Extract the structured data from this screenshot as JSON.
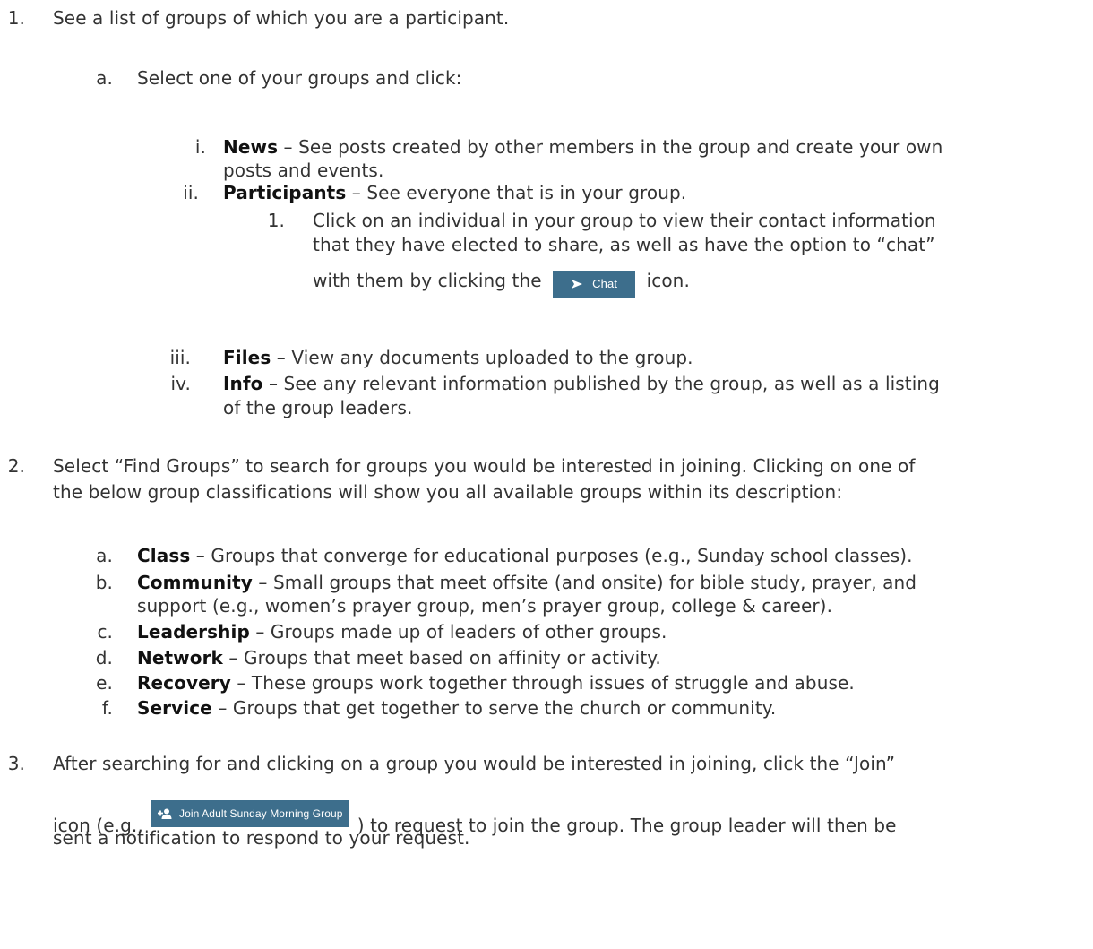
{
  "items": [
    {
      "num": "1.",
      "text": "See a list of groups of which you are a participant."
    },
    {
      "num": "a.",
      "text": "Select one of your groups and click:"
    },
    {
      "num": "i.",
      "term": "News",
      "text": " – See posts created by other members in the group and create your own",
      "cont": "posts and events."
    },
    {
      "num": "ii.",
      "term": "Participants",
      "text": " – See everyone that is in your group."
    },
    {
      "num": "1.",
      "text": "Click on an individual in your group to view their contact information",
      "cont1": "that they have elected to share, as well as have the option to “chat”",
      "cont2a": "with them by clicking the",
      "cont2b": "icon."
    },
    {
      "num": "iii.",
      "term": "Files",
      "text": " – View any documents uploaded to the group."
    },
    {
      "num": "iv.",
      "term": "Info",
      "text": " – See any relevant information published by the group, as well as a listing",
      "cont": "of the group leaders."
    },
    {
      "num": "2.",
      "text": "Select “Find Groups” to search for groups you would be interested in joining. Clicking on one of",
      "cont": "the below group classifications will show you all available groups within its description:"
    },
    {
      "num": "a.",
      "term": "Class",
      "text": " – Groups that converge for educational purposes (e.g., Sunday school classes)."
    },
    {
      "num": "b.",
      "term": "Community",
      "text": " – Small groups that meet offsite (and onsite) for bible study, prayer, and",
      "cont": "support (e.g., women’s prayer group, men’s prayer group, college & career)."
    },
    {
      "num": "c.",
      "term": "Leadership",
      "text": " – Groups made up of leaders of other groups."
    },
    {
      "num": "d.",
      "term": "Network",
      "text": " – Groups that meet based on affinity or activity."
    },
    {
      "num": "e.",
      "term": "Recovery",
      "text": " – These groups work together through issues of struggle and abuse."
    },
    {
      "num": "f.",
      "term": "Service",
      "text": " – Groups that get together to serve the church or community."
    },
    {
      "num": "3.",
      "text": "After searching for and clicking on a group you would be interested in joining, click the “Join”",
      "cont1a": "icon (e.g.,",
      "cont1b": ") to request to join the group. The group leader will then be",
      "cont2": "sent a notification to respond to your request."
    }
  ],
  "buttons": {
    "chat_label": "Chat",
    "chat_icon": "send-arrow-icon",
    "join_label": "Join Adult Sunday Morning Group",
    "join_icon": "add-user-icon",
    "color": "#3d6e8c"
  }
}
